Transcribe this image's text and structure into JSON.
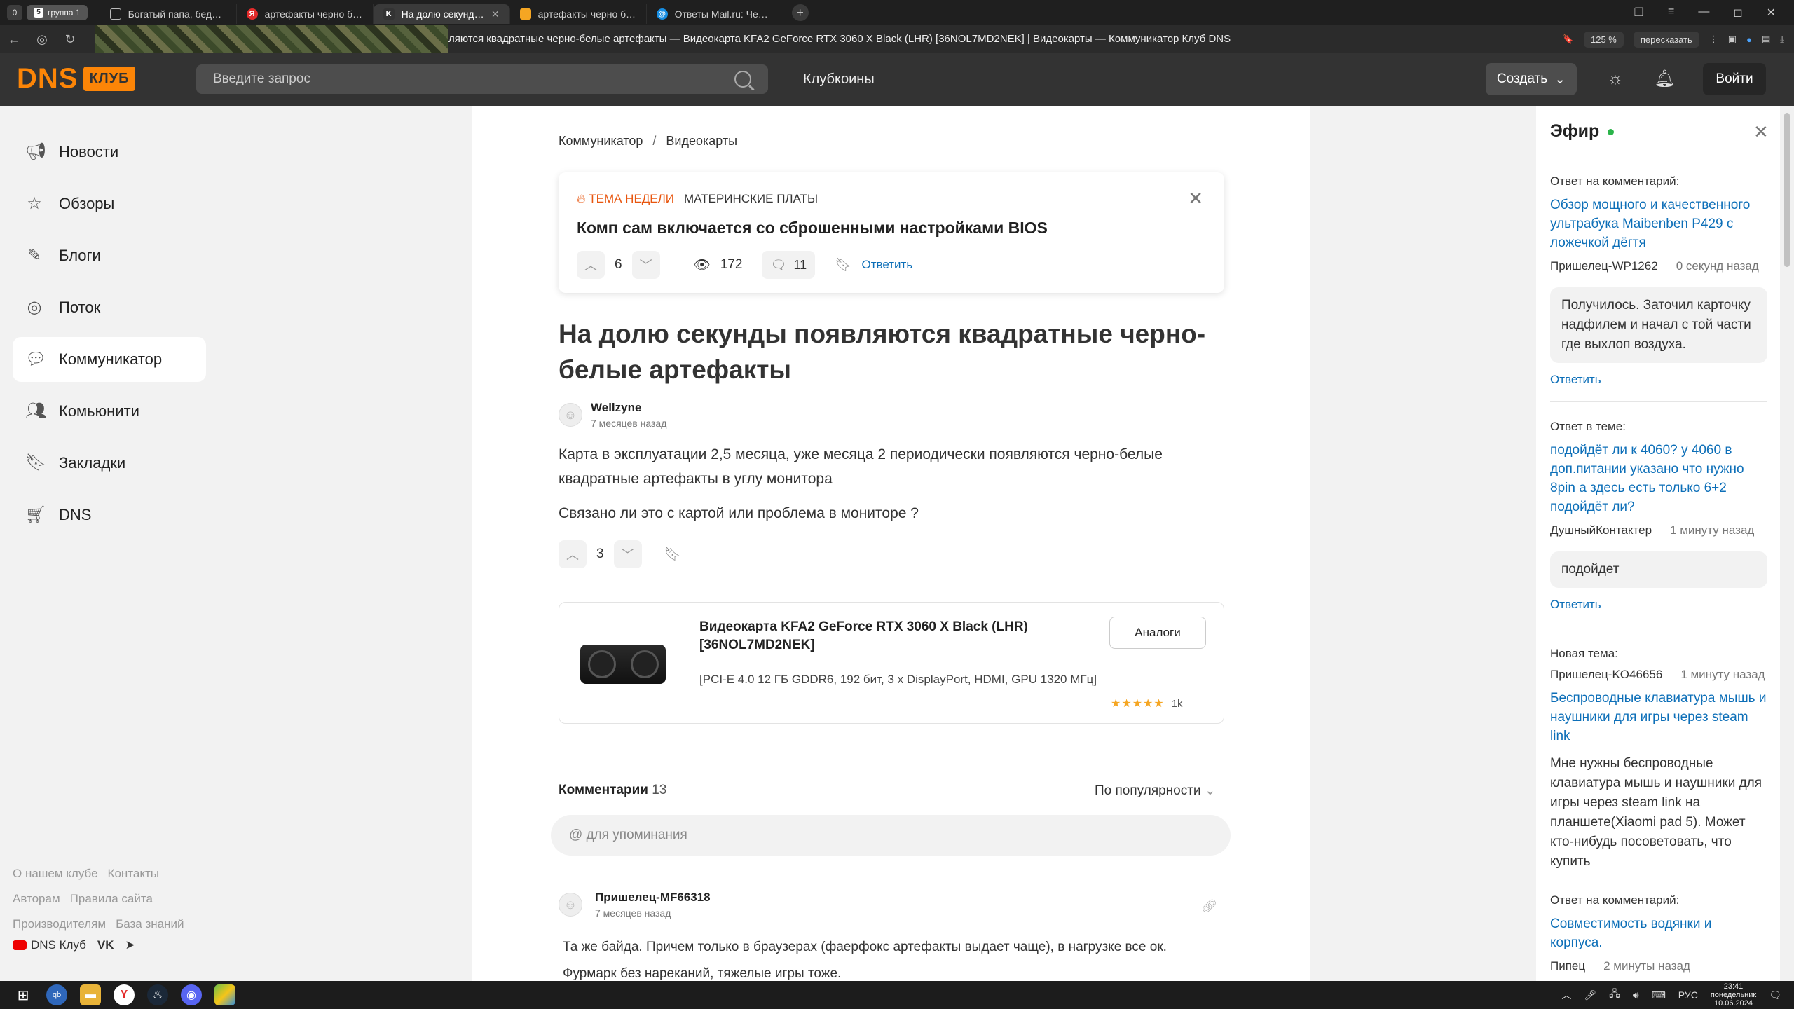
{
  "browser": {
    "tab_counter": "0",
    "group_label": "группа 1",
    "group_count": "5",
    "tabs": [
      {
        "title": "Богатый папа, бедный па",
        "icon": "document-icon",
        "color": "#444444"
      },
      {
        "title": "артефакты черно белые",
        "icon": "yandex-icon",
        "color": "#e32b2b"
      },
      {
        "title": "На долю секунды появ",
        "icon": "dns-klub-icon",
        "color": "#333333",
        "active": true
      },
      {
        "title": "артефакты черно белые",
        "icon": "yandex-images-icon",
        "color": "#f5a623"
      },
      {
        "title": "Ответы Mail.ru: Черно-бе",
        "icon": "mailru-icon",
        "color": "#168de2"
      }
    ],
    "address": "ляются квадратные черно-белые артефакты — Видеокарта KFA2 GeForce RTX 3060 X Black (LHR) [36NOL7MD2NEK] | Видеокарты — Коммуникатор Клуб DNS",
    "zoom": "125 %",
    "retell": "пересказать"
  },
  "header": {
    "logo_dns": "DNS",
    "logo_club": "КЛУБ",
    "search_placeholder": "Введите запрос",
    "clubcoins": "Клубкоины",
    "create": "Создать",
    "login": "Войти"
  },
  "sidebar": {
    "items": [
      {
        "label": "Новости",
        "icon": "megaphone-icon"
      },
      {
        "label": "Обзоры",
        "icon": "star-icon"
      },
      {
        "label": "Блоги",
        "icon": "pencil-icon"
      },
      {
        "label": "Поток",
        "icon": "spiral-icon"
      },
      {
        "label": "Коммуникатор",
        "icon": "chat-icon",
        "active": true
      },
      {
        "label": "Комьюнити",
        "icon": "users-icon"
      },
      {
        "label": "Закладки",
        "icon": "bookmark-icon"
      },
      {
        "label": "DNS",
        "icon": "cart-icon"
      }
    ],
    "footer_links": [
      "О нашем клубе",
      "Контакты",
      "Авторам",
      "Правила сайта",
      "Производителям",
      "База знаний"
    ],
    "social_label": "DNS Клуб",
    "social_vk": "VK"
  },
  "main": {
    "breadcrumbs": [
      "Коммуникатор",
      "Видеокарты"
    ],
    "topic": {
      "badge": "ТЕМА НЕДЕЛИ",
      "category": "МАТЕРИНСКИЕ ПЛАТЫ",
      "title": "Комп сам включается со сброшенными настройками BIOS",
      "votes": "6",
      "views": "172",
      "comments": "11",
      "reply": "Ответить"
    },
    "post": {
      "title": "На долю секунды появляются квадратные черно-белые артефакты",
      "author": "Wellzyne",
      "time": "7 месяцев назад",
      "text1": "Карта в эксплуатации 2,5 месяца, уже месяца 2 периодически появляются черно-белые квадратные артефакты в углу монитора",
      "text2": "Связано ли это с картой или проблема в мониторе ?",
      "votes": "3"
    },
    "product": {
      "title": "Видеокарта KFA2 GeForce RTX 3060 X Black (LHR) [36NOL7MD2NEK]",
      "specs": "[PCI-E 4.0 12 ГБ GDDR6, 192 бит, 3 x DisplayPort, HDMI, GPU 1320 МГц]",
      "analogs": "Аналоги",
      "rating": 5,
      "reviews": "1k"
    },
    "comments_header": "Комментарии",
    "comments_count": "13",
    "sort": "По популярности",
    "mention_placeholder": "@ для упоминания",
    "comment": {
      "author": "Пришелец-MF66318",
      "time": "7 месяцев назад",
      "text1": "Та же байда. Причем только в браузерах (фаерфокс артефакты выдает чаще), в нагрузке все ок.",
      "text2": "Фурмарк без нареканий, тяжелые игры тоже."
    }
  },
  "efir": {
    "title": "Эфир",
    "b1": {
      "label": "Ответ на комментарий:",
      "link": "Обзор мощного и качественного ультрабука Maibenben P429 с ложечкой дёгтя",
      "user": "Пришелец-WP1262",
      "time": "0 секунд назад",
      "text": "Получилось. Заточил карточку надфилем и начал с той части где выхлоп воздуха.",
      "reply": "Ответить"
    },
    "b2": {
      "label": "Ответ в теме:",
      "link": "подойдёт ли к 4060? у 4060 в доп.питании указано что нужно 8pin а здесь есть только 6+2 подойдёт ли?",
      "user": "ДушныйКонтактер",
      "time": "1 минуту назад",
      "text": "подойдет",
      "reply": "Ответить"
    },
    "b3": {
      "label": "Новая тема:",
      "user": "Пришелец-KO46656",
      "time": "1 минуту назад",
      "link": "Беспроводные клавиатура мышь и наушники для игры через steam link",
      "text": "Мне нужны беспроводные клавиатура мышь и наушники для игры через steam link на планшете(Xiaomi pad 5). Может кто-нибудь посоветовать, что купить"
    },
    "b4": {
      "label": "Ответ на комментарий:",
      "link": "Совместимость водянки и корпуса.",
      "user": "Пипец",
      "time": "2 минуты назад"
    }
  },
  "taskbar": {
    "lang": "РУС",
    "time": "23:41",
    "day": "понедельник",
    "date": "10.06.2024"
  },
  "colors": {
    "accent": "#fc8507",
    "link": "#0d6fb8",
    "hot": "#e8560f",
    "online": "#2bb44a"
  }
}
